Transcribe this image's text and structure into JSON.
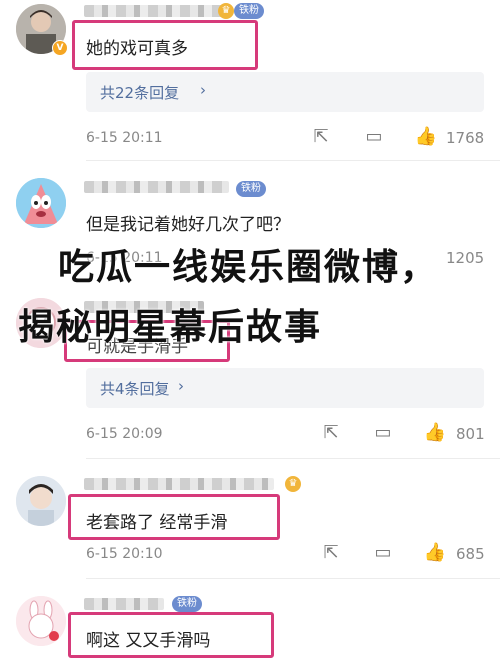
{
  "badges": {
    "tie_fan": "铁粉",
    "verified": "V"
  },
  "overlay": {
    "line1": "吃瓜一线娱乐圈微博，",
    "line2": "揭秘明星幕后故事"
  },
  "comments": [
    {
      "text": "她的戏可真多",
      "replies": "共22条回复",
      "time": "6-15 20:11",
      "likes": "1768"
    },
    {
      "text": "但是我记着她好几次了吧？",
      "time": "6-15 20:11",
      "likes": "1205"
    },
    {
      "text": "可就是手滑手",
      "replies": "共4条回复",
      "time": "6-15 20:09",
      "likes": "801"
    },
    {
      "text": "老套路了 经常手滑",
      "time": "6-15 20:10",
      "likes": "685"
    },
    {
      "text": "啊这 又又手滑吗"
    }
  ]
}
